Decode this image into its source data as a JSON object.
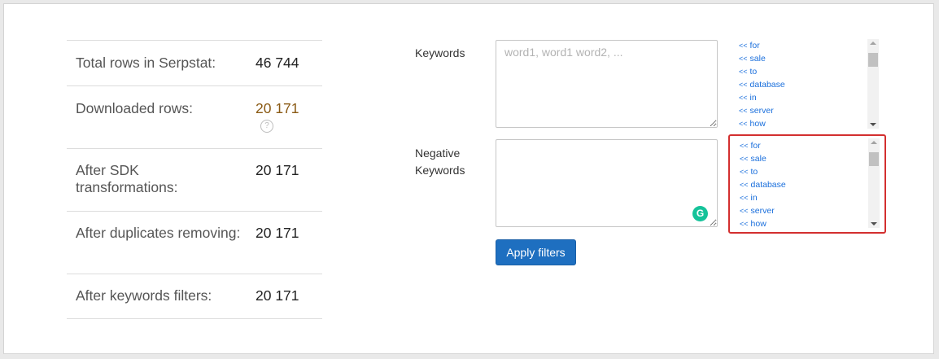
{
  "stats": [
    {
      "label": "Total rows in Serpstat:",
      "value": "46 744"
    },
    {
      "label": "Downloaded rows:",
      "value": "20 171"
    },
    {
      "label": "After SDK transformations:",
      "value": "20 171"
    },
    {
      "label": "After duplicates removing:",
      "value": "20 171"
    },
    {
      "label": "After keywords filters:",
      "value": "20 171"
    }
  ],
  "help_glyph": "?",
  "filters": {
    "keywords_label": "Keywords",
    "keywords_placeholder": "word1, word1 word2, ...",
    "keywords_value": "",
    "negative_label_line1": "Negative",
    "negative_label_line2": "Keywords",
    "negative_value": "",
    "grammarly_glyph": "G",
    "suggestions": [
      "for",
      "sale",
      "to",
      "database",
      "in",
      "server",
      "how"
    ],
    "arrow_glyph": "<<",
    "apply_label": "Apply filters"
  },
  "colors": {
    "accent_value": "#8a5a14",
    "link": "#1a6fdc",
    "button": "#1e6fc0",
    "highlight_border": "#d32f2f",
    "grammarly": "#15c39a"
  }
}
